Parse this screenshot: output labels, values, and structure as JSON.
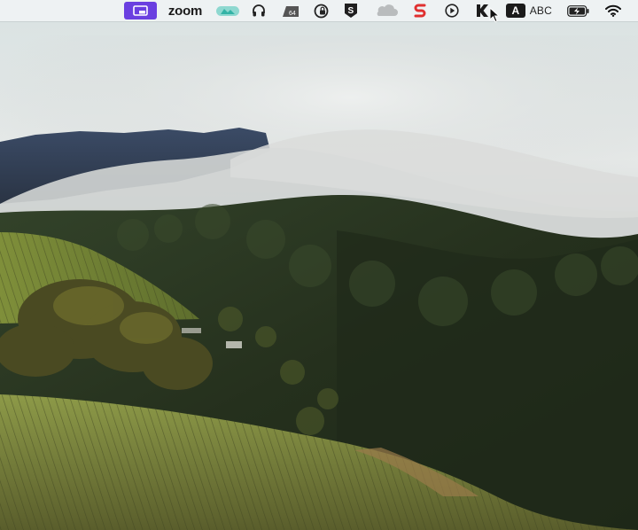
{
  "menubar": {
    "items": [
      {
        "id": "screen-recorder",
        "icon": "screen-recorder-icon",
        "accent": "#6a3fe0"
      },
      {
        "id": "zoom",
        "label": "zoom"
      },
      {
        "id": "cloud-app",
        "icon": "teal-cloud-icon",
        "accent": "#33b3a6"
      },
      {
        "id": "headphones",
        "icon": "headphones-icon"
      },
      {
        "id": "memory-monitor",
        "icon": "drive-64-icon",
        "badge": "64"
      },
      {
        "id": "vpn",
        "icon": "lock-shield-icon"
      },
      {
        "id": "s-app",
        "icon": "s-shield-icon"
      },
      {
        "id": "cloud",
        "icon": "grey-cloud-icon"
      },
      {
        "id": "scrivener",
        "icon": "red-s-icon",
        "accent": "#e0302f"
      },
      {
        "id": "play",
        "icon": "play-circle-icon"
      },
      {
        "id": "keystroke",
        "icon": "k-app-icon"
      },
      {
        "id": "input-source",
        "badge": "A",
        "label": "ABC"
      },
      {
        "id": "battery",
        "icon": "battery-charging-icon"
      },
      {
        "id": "wifi",
        "icon": "wifi-icon"
      }
    ]
  },
  "wallpaper": {
    "description": "",
    "colors": {
      "sky": "#dfe4e4",
      "fog": "#c9cccc",
      "forest": "#2c3a24",
      "vineyard": "#7d8a3c"
    }
  }
}
